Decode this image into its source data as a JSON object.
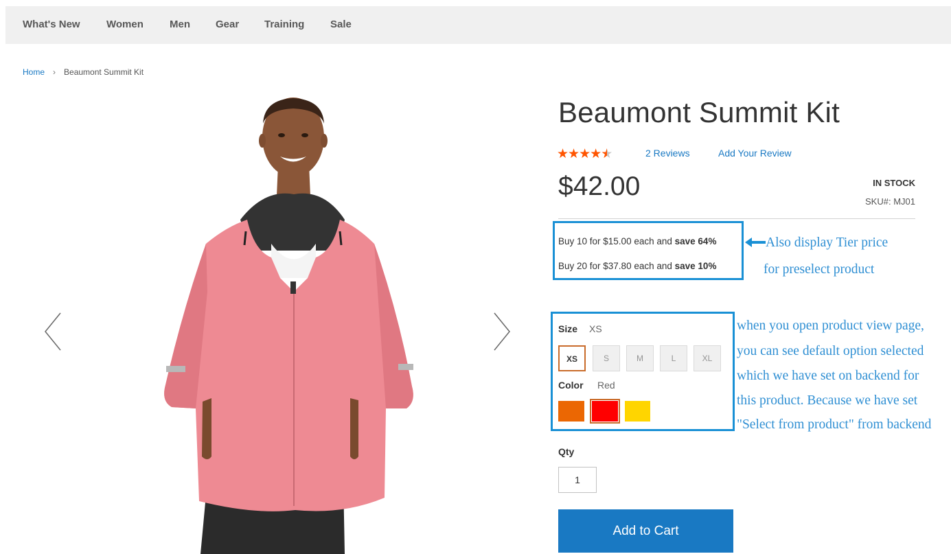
{
  "nav": {
    "items": [
      "What's New",
      "Women",
      "Men",
      "Gear",
      "Training",
      "Sale"
    ]
  },
  "breadcrumb": {
    "home": "Home",
    "separator": "›",
    "current": "Beaumont Summit Kit"
  },
  "product": {
    "title": "Beaumont Summit Kit",
    "rating_fraction": 0.9,
    "reviews_link": "2  Reviews",
    "add_review_link": "Add Your Review",
    "price": "$42.00",
    "stock": "IN STOCK",
    "sku": "SKU#:  MJ01"
  },
  "tier_prices": [
    {
      "text": "Buy 10 for $15.00 each and ",
      "save": "save 64%"
    },
    {
      "text": "Buy 20 for $37.80 each and ",
      "save": "save 10%"
    }
  ],
  "annotations": {
    "tier_note_line1": "Also display Tier price",
    "tier_note_line2": "for preselect product",
    "default_note": [
      "when you open product view page,",
      "you can see default option selected",
      "which we have set on backend for",
      "this product. Because we have set",
      "\"Select from product\" from backend"
    ]
  },
  "options": {
    "size_label": "Size",
    "size_value": "XS",
    "sizes": [
      "XS",
      "S",
      "M",
      "L",
      "XL"
    ],
    "selected_size": "XS",
    "color_label": "Color",
    "color_value": "Red",
    "colors": [
      {
        "name": "Orange",
        "hex": "#eb6703"
      },
      {
        "name": "Red",
        "hex": "#ff0000"
      },
      {
        "name": "Yellow",
        "hex": "#ffd500"
      }
    ],
    "selected_color": "Red"
  },
  "qty": {
    "label": "Qty",
    "value": "1"
  },
  "add_to_cart": "Add to Cart",
  "colors": {
    "link": "#1979c3",
    "rating": "#ff5501",
    "annotation": "#1990d5",
    "button": "#1979c3",
    "jacket": "#ee8a93"
  }
}
